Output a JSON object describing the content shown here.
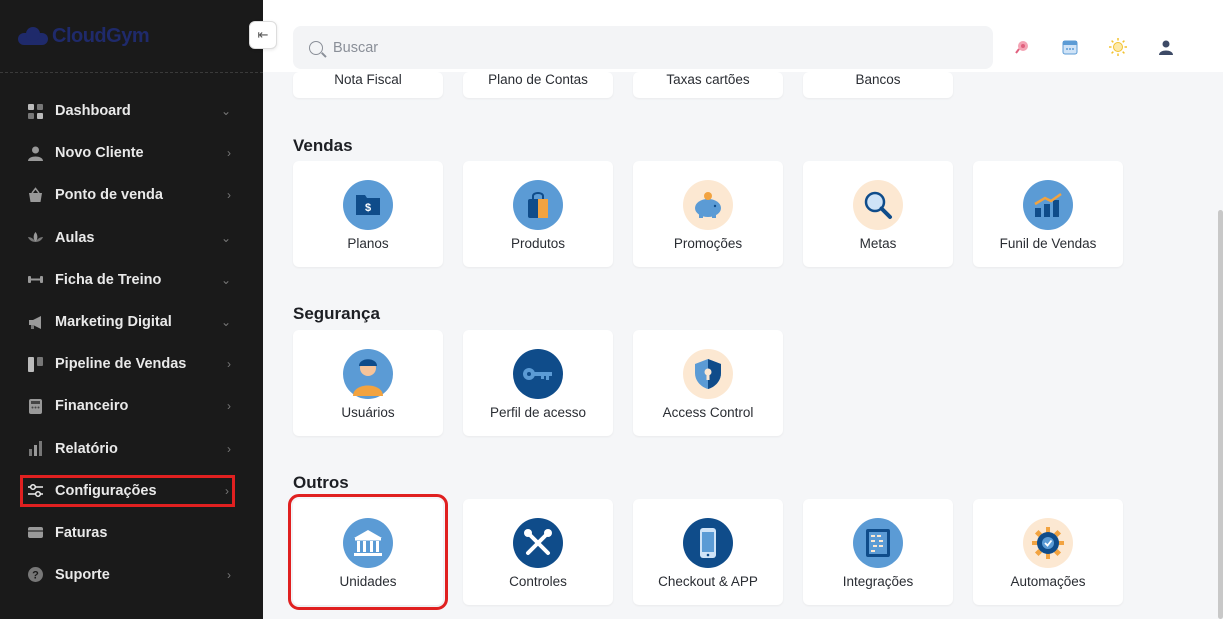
{
  "brand": {
    "name": "CloudGym"
  },
  "sidebar": {
    "items": [
      {
        "label": "Dashboard",
        "icon": "dashboard-icon",
        "chevron": "⌄"
      },
      {
        "label": "Novo Cliente",
        "icon": "user-icon",
        "chevron": "›"
      },
      {
        "label": "Ponto de venda",
        "icon": "basket-icon",
        "chevron": "›"
      },
      {
        "label": "Aulas",
        "icon": "lotus-icon",
        "chevron": "⌄"
      },
      {
        "label": "Ficha de Treino",
        "icon": "dumbbell-icon",
        "chevron": "⌄"
      },
      {
        "label": "Marketing Digital",
        "icon": "megaphone-icon",
        "chevron": "⌄"
      },
      {
        "label": "Pipeline de Vendas",
        "icon": "pipeline-icon",
        "chevron": "›"
      },
      {
        "label": "Financeiro",
        "icon": "calculator-icon",
        "chevron": "›"
      },
      {
        "label": "Relatório",
        "icon": "bar-chart-icon",
        "chevron": "›"
      },
      {
        "label": "Configurações",
        "icon": "sliders-icon",
        "chevron": "›",
        "active": true
      },
      {
        "label": "Faturas",
        "icon": "credit-card-icon",
        "chevron": ""
      },
      {
        "label": "Suporte",
        "icon": "help-icon",
        "chevron": "›"
      }
    ]
  },
  "search": {
    "placeholder": "Buscar"
  },
  "top_cards": [
    "Nota Fiscal",
    "Plano de Contas",
    "Taxas cartões",
    "Bancos"
  ],
  "sections": [
    {
      "title": "Vendas",
      "cards": [
        {
          "label": "Planos",
          "icon": "wallet-icon"
        },
        {
          "label": "Produtos",
          "icon": "shopping-bag-icon"
        },
        {
          "label": "Promoções",
          "icon": "piggy-bank-icon"
        },
        {
          "label": "Metas",
          "icon": "magnifier-icon"
        },
        {
          "label": "Funil de Vendas",
          "icon": "growth-chart-icon"
        }
      ]
    },
    {
      "title": "Segurança",
      "cards": [
        {
          "label": "Usuários",
          "icon": "person-icon"
        },
        {
          "label": "Perfil de acesso",
          "icon": "key-icon"
        },
        {
          "label": "Access Control",
          "icon": "shield-lock-icon"
        }
      ]
    },
    {
      "title": "Outros",
      "cards": [
        {
          "label": "Unidades",
          "icon": "bank-building-icon",
          "highlight": true
        },
        {
          "label": "Controles",
          "icon": "tools-icon"
        },
        {
          "label": "Checkout & APP",
          "icon": "smartphone-icon"
        },
        {
          "label": "Integrações",
          "icon": "abacus-icon"
        },
        {
          "label": "Automações",
          "icon": "gear-automation-icon"
        }
      ]
    }
  ],
  "colors": {
    "sidebar_bg": "#1a1a1a",
    "highlight": "#e02020",
    "icon_blue": "#5b9bd5",
    "icon_peach": "#fce8d2",
    "icon_navy": "#0f4c8a"
  }
}
